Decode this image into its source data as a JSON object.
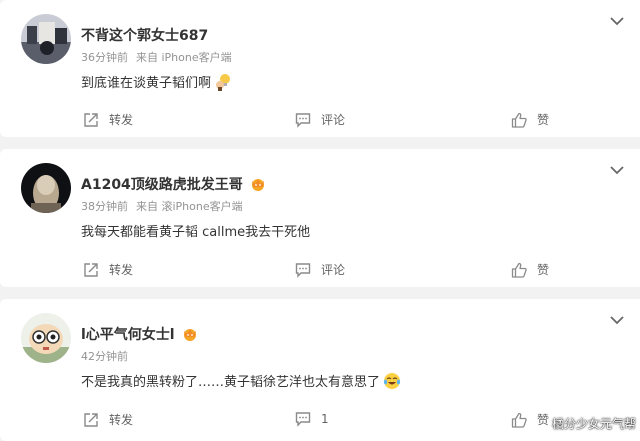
{
  "comments": [
    {
      "username": "不背这个郭女士687",
      "time": "36分钟前",
      "source": "来自 iPhone客户端",
      "text": "到底谁在谈黄子韬们啊",
      "emoji_icon": "lightbulb-thinking-icon",
      "repost_label": "转发",
      "comment_label": "评论",
      "like_label": "赞"
    },
    {
      "username": "A1204顶级路虎批发王哥",
      "badge_icon": "crown-badge-icon",
      "time": "38分钟前",
      "source": "来自 滚iPhone客户端",
      "text": "我每天都能看黄子韬 callme我去干死他",
      "repost_label": "转发",
      "comment_label": "评论",
      "like_label": "赞"
    },
    {
      "username": "l心平气何女士l",
      "badge_icon": "crown-badge-icon",
      "time": "42分钟前",
      "text": "不是我真的黑转粉了……黄子韬徐艺洋也太有意思了",
      "emoji_icon": "laughing-tears-icon",
      "repost_label": "转发",
      "comment_count": "1",
      "like_label": "赞"
    }
  ],
  "watermark": "橘分少女元气帮",
  "colors": {
    "card_bg": "#ffffff",
    "page_bg": "#f2f2f2",
    "text_main": "#333333",
    "text_meta": "#939393",
    "icon": "#8a8a8a",
    "badge": "#f5a623"
  }
}
